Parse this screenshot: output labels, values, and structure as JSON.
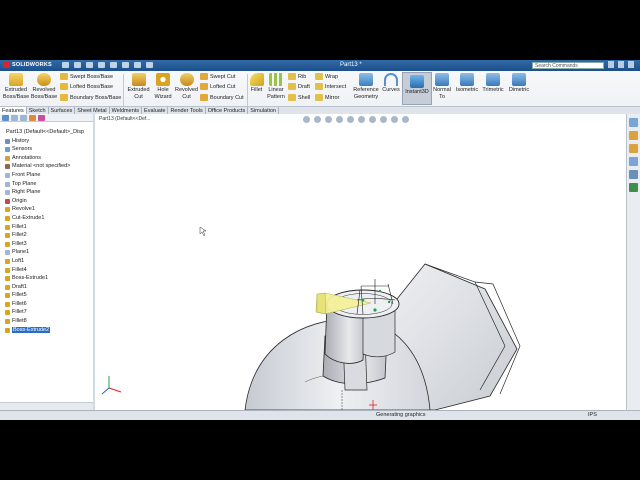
{
  "app": {
    "logo_text": "SOLIDWORKS",
    "doc_title": "Part13 *",
    "search_placeholder": "Search Commands"
  },
  "ribbon": {
    "extruded_boss": [
      "Extruded",
      "Boss/Base"
    ],
    "revolved_boss": [
      "Revolved",
      "Boss/Base"
    ],
    "swept_boss": "Swept Boss/Base",
    "lofted_boss": "Lofted Boss/Base",
    "boundary_boss": "Boundary Boss/Base",
    "extruded_cut": [
      "Extruded",
      "Cut"
    ],
    "hole_wizard": [
      "Hole",
      "Wizard"
    ],
    "revolved_cut": [
      "Revolved",
      "Cut"
    ],
    "swept_cut": "Swept Cut",
    "lofted_cut": "Lofted Cut",
    "boundary_cut": "Boundary Cut",
    "fillet": "Fillet",
    "linear_pattern": [
      "Linear",
      "Pattern"
    ],
    "rib": "Rib",
    "draft": "Draft",
    "shell": "Shell",
    "wrap": "Wrap",
    "intersect": "Intersect",
    "mirror": "Mirror",
    "reference_geometry": [
      "Reference",
      "Geometry"
    ],
    "curves": "Curves",
    "instant3d": "Instant3D",
    "normal_to": [
      "Normal",
      "To"
    ],
    "isometric": "Isometric",
    "trimetric": "Trimetric",
    "dimetric": "Dimetric"
  },
  "tabs": [
    "Features",
    "Sketch",
    "Surfaces",
    "Sheet Metal",
    "Weldments",
    "Evaluate",
    "Render Tools",
    "Office Products",
    "Simulation"
  ],
  "feature_tree": {
    "root": "Part13 (Default<<Default>_Disp",
    "items": [
      "History",
      "Sensors",
      "Annotations",
      "Material <not specified>",
      "Front Plane",
      "Top Plane",
      "Right Plane",
      "Origin",
      "Revolve1",
      "Cut-Extrude1",
      "Fillet1",
      "Fillet2",
      "Fillet3",
      "Plane1",
      "Loft1",
      "Fillet4",
      "Boss-Extrude1",
      "Draft1",
      "Fillet5",
      "Fillet6",
      "Fillet7",
      "Fillet8",
      "Boss-Extrude2"
    ],
    "selected": "Boss-Extrude2"
  },
  "viewport": {
    "part_label": "Part13 (Default<<Def..."
  },
  "status": {
    "message": "Generating graphics",
    "units": "IPS"
  },
  "colors": {
    "title_bar": "#1d4f87",
    "selection": "#2b6cc4",
    "model_fill": "#dcdfe4",
    "sketch_green": "#1fa64a",
    "extrude_yellow": "#f4f09a"
  }
}
